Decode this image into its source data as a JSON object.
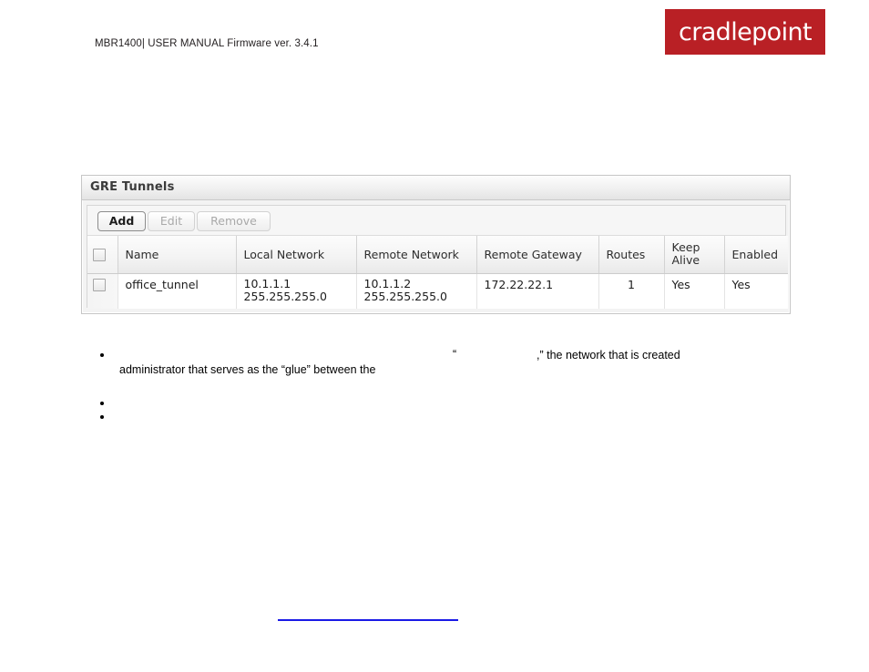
{
  "header": {
    "doc_line": "MBR1400| USER MANUAL Firmware ver. 3.4.1",
    "brand": "cradlepoint",
    "brand_color": "#b92025"
  },
  "panel": {
    "title": "GRE Tunnels",
    "toolbar": {
      "add_label": "Add",
      "edit_label": "Edit",
      "remove_label": "Remove"
    },
    "table": {
      "columns": [
        "",
        "Name",
        "Local Network",
        "Remote Network",
        "Remote Gateway",
        "Routes",
        "Keep Alive",
        "Enabled"
      ],
      "keep_alive_header_lines": [
        "Keep",
        "Alive"
      ],
      "rows": [
        {
          "selected": false,
          "name": "office_tunnel",
          "local_network_ip": "10.1.1.1",
          "local_network_mask": "255.255.255.0",
          "remote_network_ip": "10.1.1.2",
          "remote_network_mask": "255.255.255.0",
          "remote_gateway": "172.22.22.1",
          "routes": "1",
          "keep_alive": "Yes",
          "enabled": "Yes"
        }
      ]
    }
  },
  "body": {
    "bullet1_quote_open": "“",
    "bullet1_tail": ",” the network that is created",
    "bullet1_line2": "administrator that serves as the “glue” between the"
  }
}
